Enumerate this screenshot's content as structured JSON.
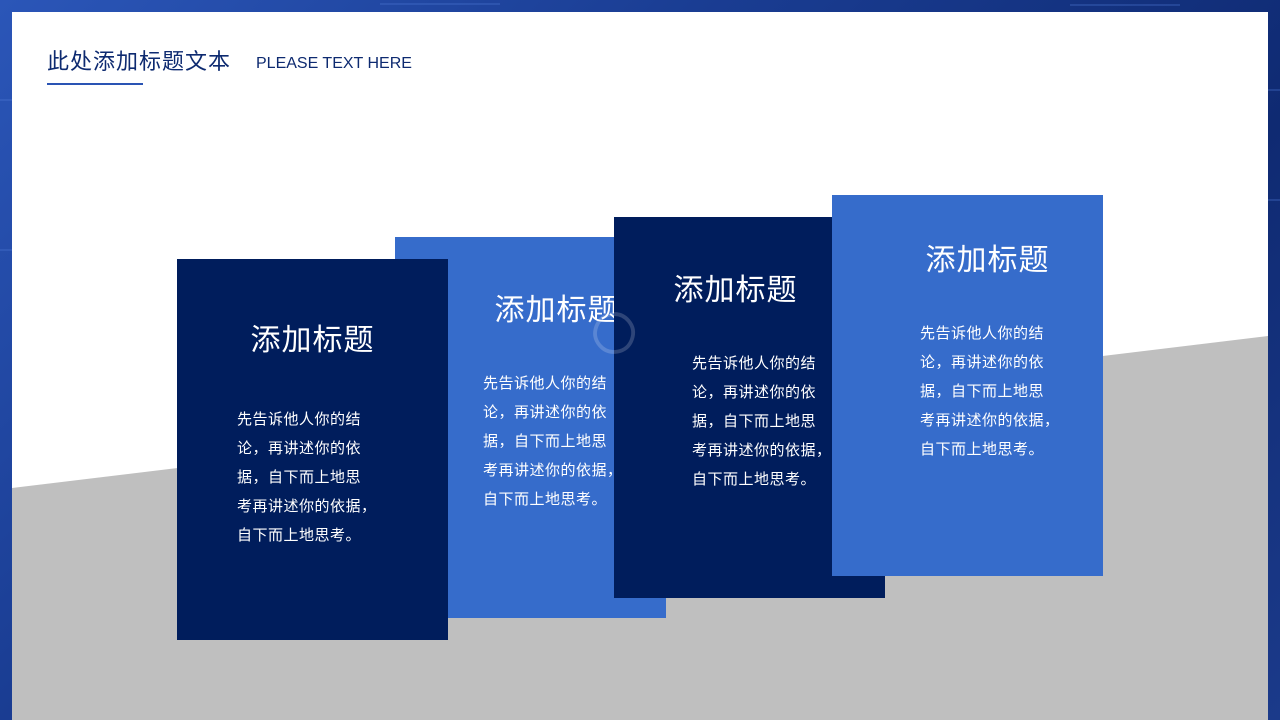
{
  "header": {
    "title": "此处添加标题文本",
    "subtitle": "PLEASE TEXT HERE"
  },
  "cards": [
    {
      "title": "添加标题",
      "text": "先告诉他人你的结\n论，再讲述你的依\n据，自下而上地思\n考再讲述你的依据，\n自下而上地思考。",
      "color": "#001d5c"
    },
    {
      "title": "添加标题",
      "text": "先告诉他人你的结\n论，再讲述你的依\n据，自下而上地思\n考再讲述你的依据，\n自下而上地思考。",
      "color": "#366ccb"
    },
    {
      "title": "添加标题",
      "text": "先告诉他人你的结\n论，再讲述你的依\n据，自下而上地思\n考再讲述你的依据，\n自下而上地思考。",
      "color": "#001d5c"
    },
    {
      "title": "添加标题",
      "text": "先告诉他人你的结\n论，再讲述你的依\n据，自下而上地思\n考再讲述你的依据，\n自下而上地思考。",
      "color": "#366ccb"
    }
  ],
  "colors": {
    "dark_blue": "#001d5c",
    "light_blue": "#366ccb",
    "grey_band": "#bfbfbf",
    "fold_shadow": "#262626"
  }
}
